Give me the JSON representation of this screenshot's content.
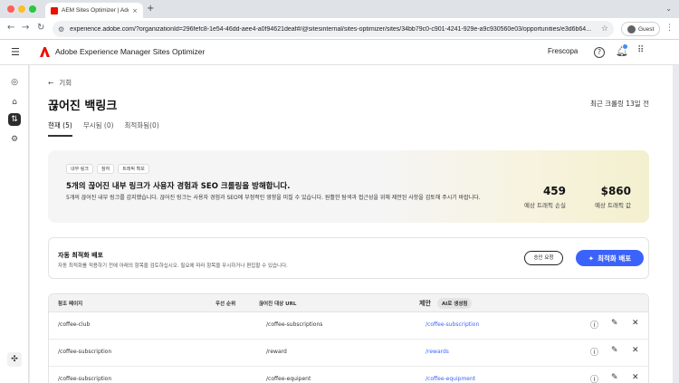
{
  "browser": {
    "tab_title": "AEM Sites Optimizer | Adobe",
    "tab_close": "×",
    "new_tab": "+",
    "url": "experience.adobe.com/?organizationId=296fefc8-1e54-46dd-aee4-a0f94621deaf#/@sitesinternal/sites-optimizer/sites/34bb79c0-c901-4241-929e-a9c930560e03/opportunities/e3d6b64...",
    "guest_label": "Guest"
  },
  "header": {
    "app_title": "Adobe Experience Manager Sites Optimizer",
    "org_name": "Frescopa"
  },
  "page": {
    "back_label": "기회",
    "title": "끊어진 백링크",
    "last_crawl": "최근 크롤링 13일 전",
    "tabs": [
      {
        "label": "현재 (5)"
      },
      {
        "label": "무시됨 (0)"
      },
      {
        "label": "최적화됨(0)"
      }
    ]
  },
  "banner": {
    "tags": [
      "내부 링크",
      "참여",
      "트래픽 확보"
    ],
    "title": "5개의 끊어진 내부 링크가 사용자 경험과 SEO 크롤링을 방해합니다.",
    "description": "5개의 끊어진 내부 링크를 감지했습니다. 끊어진 링크는 사용자 경험과 SEO에 부정적인 영향을 미칠 수 있습니다. 원활한 탐색과 접근성을 위해 제안된 사항을 검토해 주시기 바랍니다.",
    "metrics": [
      {
        "value": "459",
        "label": "예상 트래픽 손실"
      },
      {
        "value": "$860",
        "label": "예상 트래픽 값"
      }
    ]
  },
  "deploy": {
    "title": "자동 최적화 배포",
    "description": "자동 최적화를 적용하기 전에 아래의 항목을 검토하십시오. 필요에 따라 항목을 무시하거나 편집할 수 있습니다.",
    "approve_label": "승인 요청",
    "deploy_label": "최적화 배포"
  },
  "table": {
    "headers": {
      "ref_page": "참조 페이지",
      "priority": "우선 순위",
      "broken_url": "끊어진 대상 URL",
      "suggestion": "제안",
      "ai_badge": "AI로 생성됨"
    },
    "rows": [
      {
        "ref": "/coffee-club",
        "target": "/coffee-subscriptions",
        "suggestion": "/coffee-subscription"
      },
      {
        "ref": "/coffee-subscription",
        "target": "/reward",
        "suggestion": "/rewards"
      },
      {
        "ref": "/coffee-subscription",
        "target": "/coffee-equipent",
        "suggestion": "/coffee-equipment"
      }
    ]
  },
  "colors": {
    "accent": "#3b63fb",
    "adobe_red": "#eb1000",
    "notification": "#3d8ff2"
  }
}
